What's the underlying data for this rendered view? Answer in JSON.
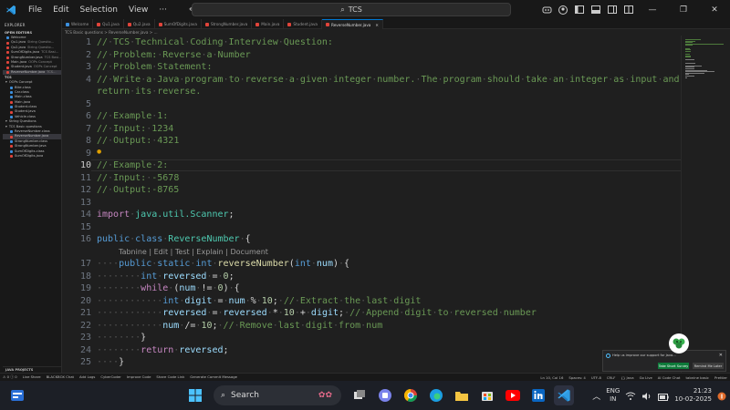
{
  "titlebar": {
    "menus": [
      "File",
      "Edit",
      "Selection",
      "View",
      "···"
    ],
    "search_text": "TCS"
  },
  "sidebar": {
    "header": "EXPLORER",
    "open_editors_title": "OPEN EDITORS",
    "open_editors": [
      {
        "name": "Welcome",
        "extra": "",
        "color": "#3c8fdd"
      },
      {
        "name": "Qu1.java",
        "extra": "String Questio…",
        "color": "#e0443a"
      },
      {
        "name": "Qu2.java",
        "extra": "String Questio…",
        "color": "#e0443a"
      },
      {
        "name": "SumOfDigits.java",
        "extra": "TCS Basi…",
        "color": "#e0443a"
      },
      {
        "name": "StrongNumber.java",
        "extra": "TCS Basi…",
        "color": "#e0443a"
      },
      {
        "name": "Main.java",
        "extra": "OOPs Concept",
        "color": "#e0443a"
      },
      {
        "name": "Student.java",
        "extra": "OOPs Concept",
        "color": "#e0443a"
      },
      {
        "name": "ReverseNumber.java",
        "extra": "TCS…",
        "color": "#e0443a",
        "active": true
      }
    ],
    "project_title": "TCS",
    "tree": [
      {
        "name": "OOPs Concept",
        "folder": true
      },
      {
        "name": "Bike.class",
        "color": "#3c8fdd"
      },
      {
        "name": "Car.class",
        "color": "#3c8fdd"
      },
      {
        "name": "Main.class",
        "color": "#3c8fdd"
      },
      {
        "name": "Main.java",
        "color": "#e0443a"
      },
      {
        "name": "Student.class",
        "color": "#3c8fdd"
      },
      {
        "name": "Student.java",
        "color": "#e0443a"
      },
      {
        "name": "Vehicle.class",
        "color": "#3c8fdd"
      },
      {
        "name": "String Questions",
        "folder": true
      },
      {
        "name": "TCS Basic questions",
        "folder": true
      },
      {
        "name": "ReverseNumber.class",
        "color": "#3c8fdd"
      },
      {
        "name": "ReverseNumber.java",
        "color": "#e0443a",
        "active": true
      },
      {
        "name": "StrongNumber.class",
        "color": "#3c8fdd"
      },
      {
        "name": "StrongNumber.java",
        "color": "#e0443a"
      },
      {
        "name": "SumOfDigits.class",
        "color": "#3c8fdd"
      },
      {
        "name": "SumOfDigits.java",
        "color": "#e0443a"
      }
    ],
    "bottom_section": "JAVA PROJECTS"
  },
  "tabs": [
    {
      "label": "Welcome",
      "active": false
    },
    {
      "label": "Qu1.java",
      "active": false
    },
    {
      "label": "Qu2.java",
      "active": false
    },
    {
      "label": "SumOfDigits.java",
      "active": false
    },
    {
      "label": "StrongNumber.java",
      "active": false
    },
    {
      "label": "Main.java",
      "active": false
    },
    {
      "label": "Student.java",
      "active": false
    },
    {
      "label": "ReverseNumber.java",
      "active": true
    }
  ],
  "breadcrumb": "TCS Basic questions > ReverseNumber.java > ...",
  "editor": {
    "current_line": 10,
    "codelens": "Tabnine | Edit | Test | Explain | Document",
    "lines": [
      {
        "n": 1,
        "text": "// TCS Technical Coding Interview Question:",
        "kind": "comment"
      },
      {
        "n": 2,
        "text": "// Problem: Reverse a Number",
        "kind": "comment"
      },
      {
        "n": 3,
        "text": "// Problem Statement:",
        "kind": "comment"
      },
      {
        "n": 4,
        "text": "// Write a Java program to reverse a given integer number. The program should take an integer as input and",
        "kind": "comment"
      },
      {
        "n": null,
        "text": "return its reverse.",
        "kind": "comment"
      },
      {
        "n": 5,
        "text": "",
        "kind": "plain"
      },
      {
        "n": 6,
        "text": "// Example 1:",
        "kind": "comment"
      },
      {
        "n": 7,
        "text": "// Input: 1234",
        "kind": "comment"
      },
      {
        "n": 8,
        "text": "// Output: 4321",
        "kind": "comment"
      },
      {
        "n": 9,
        "text": "",
        "kind": "plain"
      },
      {
        "n": 10,
        "text": "// Example 2:",
        "kind": "comment"
      },
      {
        "n": 11,
        "text": "// Input: -5678",
        "kind": "comment"
      },
      {
        "n": 12,
        "text": "// Output:-8765",
        "kind": "comment"
      },
      {
        "n": 13,
        "text": "",
        "kind": "plain"
      },
      {
        "n": 14,
        "text": "import java.util.Scanner;",
        "kind": "import"
      },
      {
        "n": 15,
        "text": "",
        "kind": "plain"
      },
      {
        "n": 16,
        "text": "public class ReverseNumber {",
        "kind": "class"
      },
      {
        "n": null,
        "text": "",
        "kind": "lens"
      },
      {
        "n": 17,
        "text": "    public static int reverseNumber(int num) {",
        "kind": "method"
      },
      {
        "n": 18,
        "text": "        int reversed = 0;",
        "kind": "decl"
      },
      {
        "n": 19,
        "text": "        while (num != 0) {",
        "kind": "while"
      },
      {
        "n": 20,
        "text": "            int digit = num % 10; // Extract the last digit",
        "kind": "digit"
      },
      {
        "n": 21,
        "text": "            reversed = reversed * 10 + digit; // Append digit to reversed number",
        "kind": "append"
      },
      {
        "n": 22,
        "text": "            num /= 10; // Remove last digit from num",
        "kind": "divide"
      },
      {
        "n": 23,
        "text": "        }",
        "kind": "plain"
      },
      {
        "n": 24,
        "text": "        return reversed;",
        "kind": "return"
      },
      {
        "n": 25,
        "text": "    }",
        "kind": "plain"
      }
    ]
  },
  "statusbar": {
    "left": [
      "⚠ 0  ⓘ 0",
      "Live Share",
      "BLACKBOX Chat",
      "Add Logs",
      "CyberCoder",
      "Improve Code",
      "Share Code Link",
      "Generate Commit Message"
    ],
    "right": [
      "Ln 10, Col 16",
      "Spaces: 4",
      "UTF-8",
      "CRLF",
      "{} Java",
      "Go Live",
      "AI Code Chat",
      "tabnine basic",
      "Prettier"
    ]
  },
  "notification": {
    "message": "Help us improve our support for Java...",
    "primary_button": "Take Short Survey",
    "secondary_button": "Remind Me Later"
  },
  "taskbar": {
    "search_label": "Search",
    "language_line1": "ENG",
    "language_line2": "IN",
    "time": "21:23",
    "date": "10-02-2025"
  }
}
